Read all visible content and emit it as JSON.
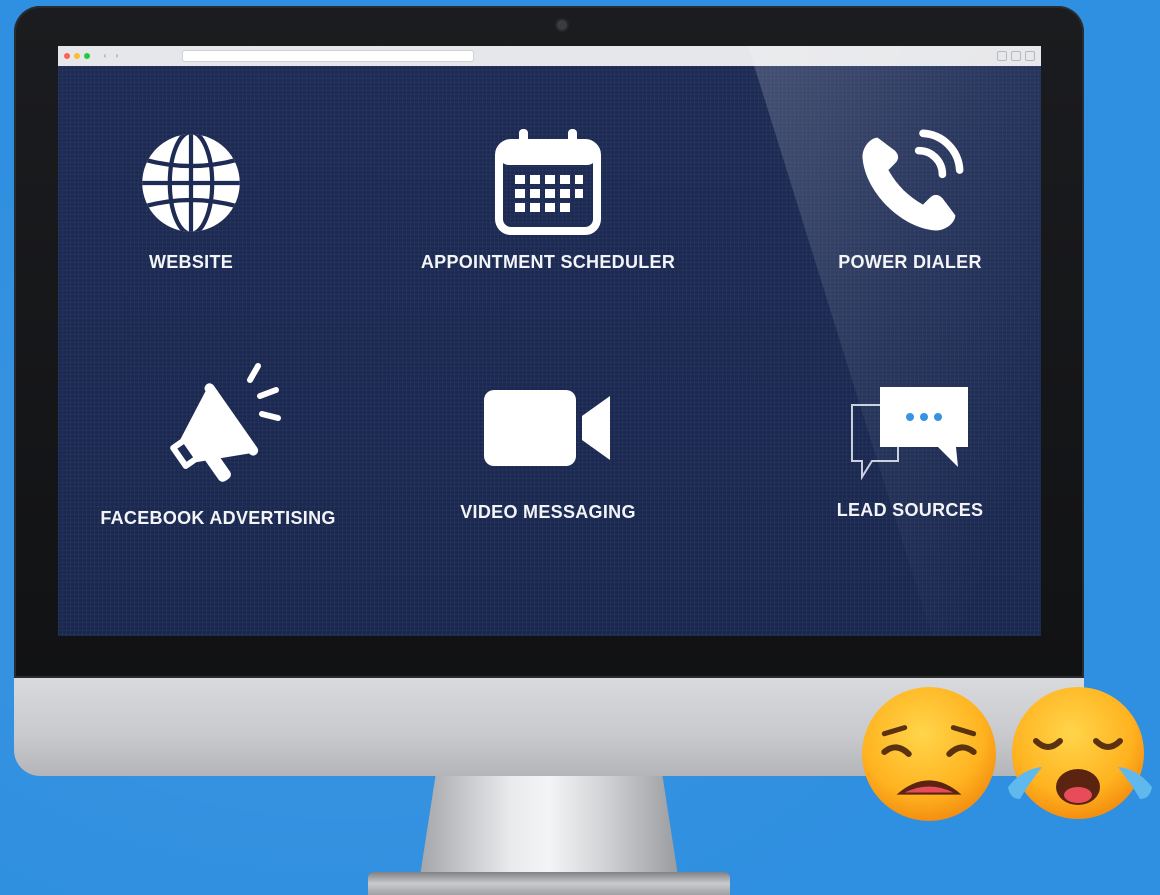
{
  "colors": {
    "background": "#2f8fe0",
    "screen": "#1d2b55",
    "icon": "#ffffff",
    "chat_dots": "#2f8fe0",
    "emoji_face": "#ffb320",
    "tears": "#5fb8ee"
  },
  "features": [
    {
      "label": "WEBSITE",
      "icon": "globe-icon"
    },
    {
      "label": "APPOINTMENT SCHEDULER",
      "icon": "calendar-icon"
    },
    {
      "label": "POWER DIALER",
      "icon": "phone-icon"
    },
    {
      "label": "FACEBOOK ADVERTISING",
      "icon": "megaphone-icon"
    },
    {
      "label": "VIDEO MESSAGING",
      "icon": "video-camera-icon"
    },
    {
      "label": "LEAD SOURCES",
      "icon": "chat-bubbles-icon"
    }
  ],
  "emojis": [
    "weary-face-emoji",
    "loudly-crying-face-emoji"
  ]
}
